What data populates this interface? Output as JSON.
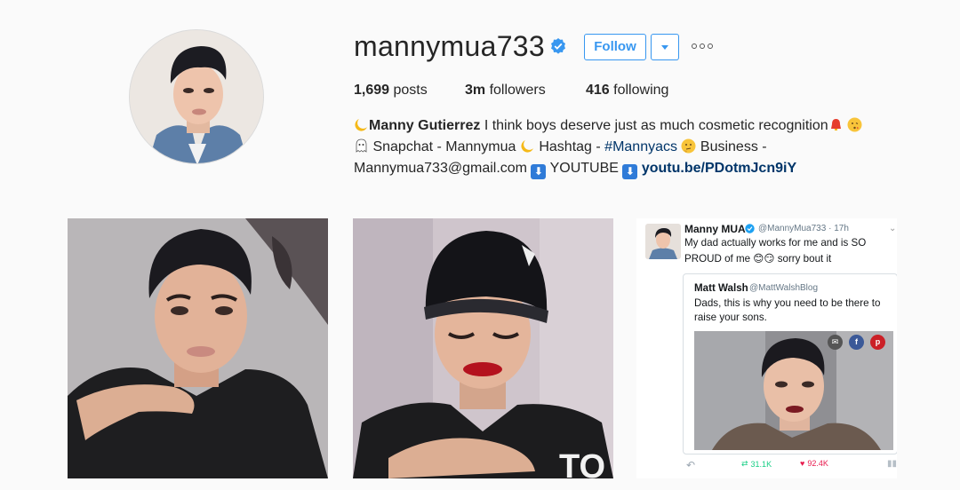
{
  "profile": {
    "username": "mannymua733",
    "follow_label": "Follow",
    "stats": {
      "posts_count": "1,699",
      "posts_label": "posts",
      "followers_count": "3m",
      "followers_label": "followers",
      "following_count": "416",
      "following_label": "following"
    },
    "bio": {
      "full_name": "Manny Gutierrez",
      "line1_text": "I think boys deserve just as much cosmetic recognition",
      "snapchat_text": "Snapchat - Mannymua",
      "hashtag_prefix": "Hashtag -",
      "hashtag": "#Mannyacs",
      "business_text": "Business -",
      "email": "Mannymua733@gmail.com",
      "youtube_text": "YOUTUBE",
      "link": "youtu.be/PDotmJcn9iY"
    }
  },
  "posts": [
    {
      "kind": "photo",
      "subject": "selfie-in-black-tshirt"
    },
    {
      "kind": "photo",
      "subject": "beanie-red-lips"
    },
    {
      "kind": "tweet-screenshot",
      "tweet": {
        "name": "Manny MUA",
        "handle": "@MannyMua733 · 17h",
        "text": "My dad actually works for me and is SO PROUD of me 😊😏 sorry bout it",
        "quote": {
          "name": "Matt Walsh",
          "handle": "@MattWalshBlog",
          "text": "Dads, this is why you need to be there to raise your sons."
        },
        "retweets": "31.1K",
        "likes": "92.4K"
      }
    }
  ],
  "colors": {
    "accent": "#3897f0",
    "link": "#003569",
    "background": "#fafafa",
    "retweet": "#19cf86",
    "like": "#e81c4f"
  },
  "icons": [
    "verified-badge-icon",
    "chevron-down-icon",
    "more-options-icon",
    "moon-emoji-icon",
    "bell-emoji-icon",
    "kiss-emoji-icon",
    "ghost-emoji-icon",
    "thinking-emoji-icon",
    "down-arrow-emoji-icon"
  ]
}
